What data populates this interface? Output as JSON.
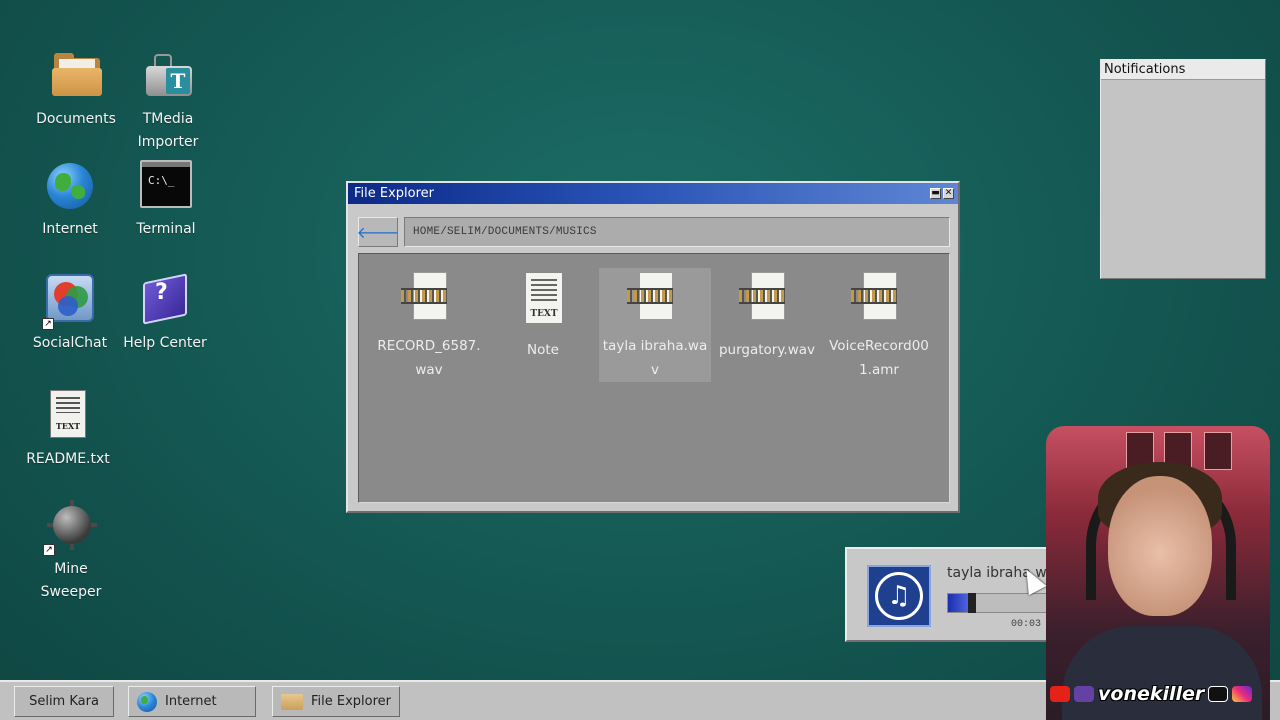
{
  "desktop": {
    "icons": [
      {
        "label": "Documents",
        "icon": "folder-icon"
      },
      {
        "label": "TMedia\nImporter",
        "icon": "tmedia-importer-icon"
      },
      {
        "label": "Internet",
        "icon": "globe-icon"
      },
      {
        "label": "Terminal",
        "icon": "terminal-icon"
      },
      {
        "label": "SocialChat",
        "icon": "socialchat-icon"
      },
      {
        "label": "Help Center",
        "icon": "help-book-icon"
      },
      {
        "label": "README.txt",
        "icon": "text-document-icon"
      },
      {
        "label": "Mine\nSweeper",
        "icon": "mine-icon"
      }
    ],
    "terminal_glyph": "C:\\_",
    "shortcut_glyph": "↗",
    "text_tag": "TEXT"
  },
  "file_explorer": {
    "title": "File Explorer",
    "minimize_glyph": "▬",
    "close_glyph": "✕",
    "back_glyph": "🡐",
    "path": "HOME/SELIM/DOCUMENTS/MUSICS",
    "files": [
      {
        "name": "RECORD_6587.wav",
        "type": "audio"
      },
      {
        "name": "Note",
        "type": "text"
      },
      {
        "name": "tayla ibraha.wav",
        "type": "audio",
        "selected": true
      },
      {
        "name": "purgatory.wav",
        "type": "audio"
      },
      {
        "name": "VoiceRecord001.amr",
        "type": "audio"
      }
    ]
  },
  "notifications": {
    "title": "Notifications"
  },
  "media_player": {
    "track": "tayla ibraha.wav",
    "time": "00:03 /",
    "progress": 0.24,
    "note_glyph": "♫"
  },
  "taskbar": {
    "user": "Selim Kara",
    "items": [
      {
        "label": "Internet",
        "icon": "globe-icon"
      },
      {
        "label": "File Explorer",
        "icon": "folder-icon"
      }
    ]
  },
  "webcam": {
    "brand": "vonekiller"
  },
  "colors": {
    "desktop": "#145752",
    "titlebar": "#0c2a88",
    "progress": "#1b2fae"
  }
}
